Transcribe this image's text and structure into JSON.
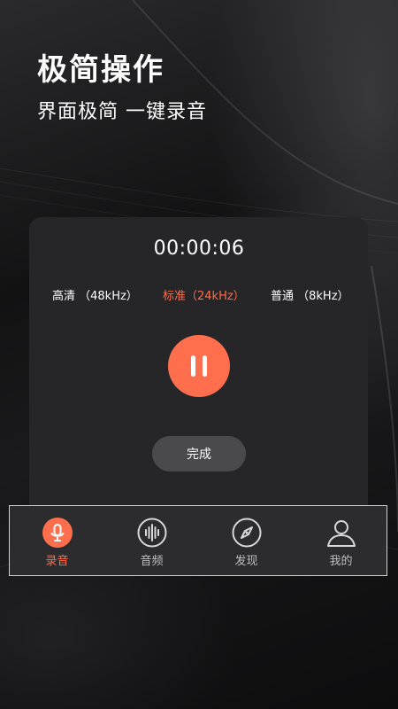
{
  "hero": {
    "title": "极简操作",
    "subtitle": "界面极简 一键录音"
  },
  "recorder": {
    "elapsed": "00:00:06",
    "qualities": [
      {
        "label": "高清 （48kHz）",
        "selected": false
      },
      {
        "label": "标准（24kHz）",
        "selected": true
      },
      {
        "label": "普通 （8kHz）",
        "selected": false
      }
    ],
    "pause_icon": "pause-icon",
    "done_label": "完成"
  },
  "tabs": [
    {
      "label": "录音",
      "icon": "microphone-icon",
      "active": true
    },
    {
      "label": "音频",
      "icon": "sound-wave-icon",
      "active": false
    },
    {
      "label": "发现",
      "icon": "compass-icon",
      "active": false
    },
    {
      "label": "我的",
      "icon": "user-icon",
      "active": false
    }
  ],
  "colors": {
    "accent": "#ff6f4d",
    "card": "#262628",
    "done_button": "#4a4a4c",
    "tab_inactive": "#bfbfbf"
  }
}
